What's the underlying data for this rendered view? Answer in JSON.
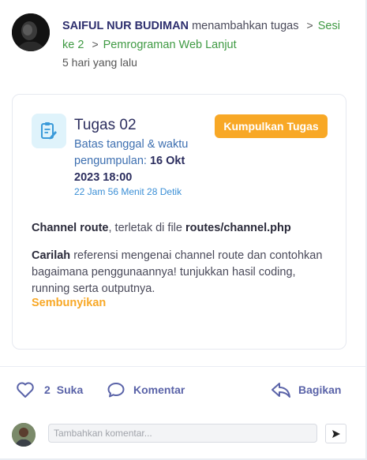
{
  "post": {
    "author": "SAIFUL NUR BUDIMAN",
    "action": "menambahkan tugas",
    "breadcrumb": [
      "Sesi ke 2",
      "Pemrograman Web Lanjut"
    ],
    "timestamp": "5 hari yang lalu"
  },
  "task": {
    "icon": "assignment-icon",
    "title": "Tugas 02",
    "submit_label": "Kumpulkan Tugas",
    "deadline_label": "Batas tanggal & waktu pengumpulan:",
    "deadline_date": "16 Okt 2023 18:00",
    "countdown": "22 Jam 56 Menit 28 Detik",
    "desc1_bold": "Channel route",
    "desc1_mid": ", terletak di file ",
    "desc1_file": "routes/channel.php",
    "desc2_bold": "Carilah",
    "desc2_rest": " referensi mengenai channel route dan contohkan bagaimana penggunaannya! tunjukkan hasil coding, running serta outputnya.",
    "hide_label": "Sembunyikan"
  },
  "actions": {
    "like_count": "2",
    "like_label": "Suka",
    "comment_label": "Komentar",
    "share_label": "Bagikan"
  },
  "comment": {
    "placeholder": "Tambahkan komentar..."
  },
  "colors": {
    "accent_orange": "#f8a826",
    "link_green": "#3f9a43",
    "action_purple": "#5a63a8",
    "title_navy": "#2b2d5e"
  }
}
